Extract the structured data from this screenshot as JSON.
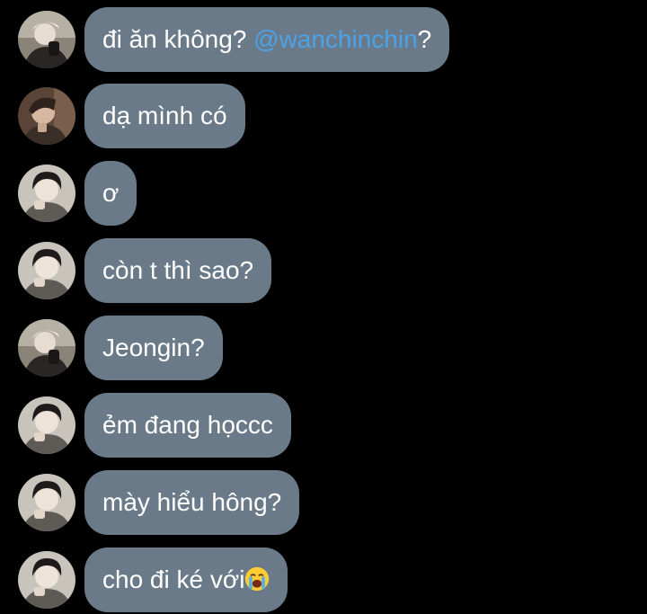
{
  "messages": [
    {
      "avatar": "avatar-user-1",
      "text_before": "đi ăn không? ",
      "mention": "@wanchinchin",
      "text_after": "?"
    },
    {
      "avatar": "avatar-user-2",
      "text": "dạ mình có"
    },
    {
      "avatar": "avatar-user-3",
      "text": "ơ"
    },
    {
      "avatar": "avatar-user-3",
      "text": "còn t thì sao?"
    },
    {
      "avatar": "avatar-user-1",
      "text": "Jeongin?"
    },
    {
      "avatar": "avatar-user-3",
      "text": "ẻm đang họccc"
    },
    {
      "avatar": "avatar-user-3",
      "text": "mày hiểu hông?"
    },
    {
      "avatar": "avatar-user-3",
      "text": "cho đi ké với",
      "emoji": "crying-face-emoji"
    }
  ],
  "colors": {
    "background": "#000000",
    "bubble": "#6a7a88",
    "text": "#ffffff",
    "mention": "#4aa3e8"
  }
}
